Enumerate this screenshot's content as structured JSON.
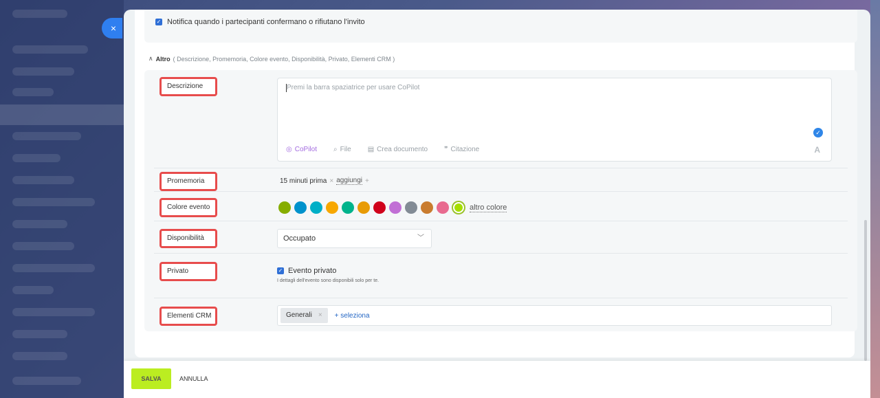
{
  "close_button": {
    "icon": "close-icon",
    "glyph": "×"
  },
  "notify": {
    "label": "Notifica quando i partecipanti confermano o rifiutano l'invito",
    "checked": true
  },
  "altro": {
    "title": "Altro",
    "summary": "( Descrizione,  Promemoria,  Colore evento,  Disponibilità,  Privato,  Elementi CRM )"
  },
  "fields": {
    "descrizione": {
      "label": "Descrizione",
      "placeholder": "Premi la barra spaziatrice per usare CoPilot",
      "toolbar": {
        "copilot": "CoPilot",
        "file": "File",
        "document": "Crea documento",
        "quote": "Citazione"
      }
    },
    "promemoria": {
      "label": "Promemoria",
      "value": "15 minuti prima",
      "add": "aggiungi"
    },
    "colore": {
      "label": "Colore evento",
      "colors": [
        "#86ad00",
        "#0092cc",
        "#00afc7",
        "#f7a700",
        "#00b38c",
        "#e89b06",
        "#d0021b",
        "#c16fd5",
        "#828b95",
        "#c97c2f",
        "#e86a8f",
        "#a5de00"
      ],
      "more": "altro colore"
    },
    "disponibilita": {
      "label": "Disponibilità",
      "value": "Occupato"
    },
    "privato": {
      "label": "Privato",
      "checkbox": "Evento privato",
      "hint": "I dettagli dell'evento sono disponibili solo per te.",
      "checked": true
    },
    "crm": {
      "label": "Elementi CRM",
      "tag": "Generali",
      "select": "+ seleziona"
    }
  },
  "footer": {
    "save": "SALVA",
    "cancel": "ANNULLA"
  }
}
